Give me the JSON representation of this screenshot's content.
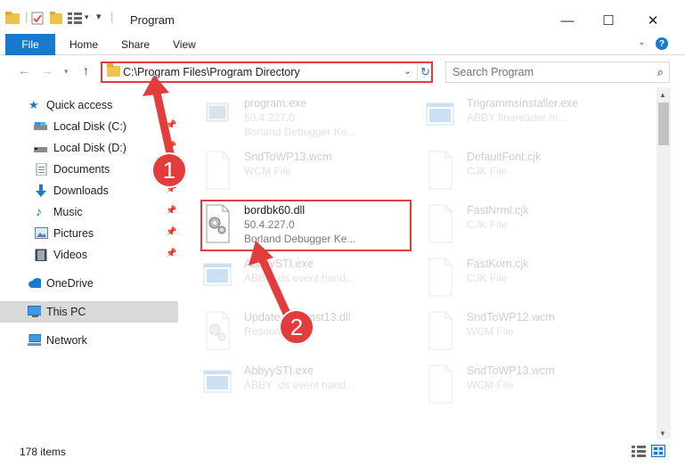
{
  "window": {
    "title": "Program",
    "minimize_glyph": "—",
    "maximize_glyph": "☐",
    "close_glyph": "✕"
  },
  "ribbon": {
    "tabs": [
      "File",
      "Home",
      "Share",
      "View"
    ],
    "help_label": "?"
  },
  "address_bar": {
    "path": "C:\\Program Files\\Program Directory"
  },
  "search": {
    "placeholder": "Search Program"
  },
  "sidebar": {
    "items": [
      {
        "label": "Quick access",
        "icon": "star-icon"
      },
      {
        "label": "Local Disk (C:)",
        "icon": "drive-icon",
        "pinned": true
      },
      {
        "label": "Local Disk (D:)",
        "icon": "drive-icon",
        "pinned": true
      },
      {
        "label": "Documents",
        "icon": "documents-icon",
        "pinned": true
      },
      {
        "label": "Downloads",
        "icon": "downloads-icon",
        "pinned": true
      },
      {
        "label": "Music",
        "icon": "music-icon",
        "pinned": true
      },
      {
        "label": "Pictures",
        "icon": "pictures-icon",
        "pinned": true
      },
      {
        "label": "Videos",
        "icon": "videos-icon",
        "pinned": true
      },
      {
        "label": "OneDrive",
        "icon": "onedrive-icon"
      },
      {
        "label": "This PC",
        "icon": "this-pc-icon",
        "selected": true
      },
      {
        "label": "Network",
        "icon": "network-icon"
      }
    ]
  },
  "files": [
    {
      "name": "program.exe",
      "line1": "50.4.227.0",
      "line2": "Borland Debugger Ke...",
      "icon": "exe-icon",
      "faded": true
    },
    {
      "name": "Trigrammsinstaller.exe",
      "line1": "ABBY finereader tri...",
      "line2": "",
      "icon": "app-window-icon",
      "faded": true
    },
    {
      "name": "SndToWP13.wcm",
      "line1": "WCM File",
      "line2": "",
      "icon": "file-icon",
      "faded": true
    },
    {
      "name": "DefaultFont.cjk",
      "line1": "CJK File",
      "line2": "",
      "icon": "file-icon",
      "faded": true
    },
    {
      "name": "bordbk60.dll",
      "line1": "50.4.227.0",
      "line2": "Borland Debugger Ke...",
      "icon": "dll-gear-icon",
      "faded": false
    },
    {
      "name": "FastNrml.cjk",
      "line1": "CJK File",
      "line2": "",
      "icon": "file-icon",
      "faded": true
    },
    {
      "name": "AbbyySTI.exe",
      "line1": "ABBY .ds event hand...",
      "line2": "",
      "icon": "app-window-icon",
      "faded": true
    },
    {
      "name": "FastKorn.cjk",
      "line1": "CJK File",
      "line2": "",
      "icon": "file-icon",
      "faded": true
    },
    {
      "name": "Update_1Uninst13.dll",
      "line1": "Resource DLL",
      "line2": "",
      "icon": "dll-gear-icon",
      "faded": true
    },
    {
      "name": "SndToWP12.wcm",
      "line1": "WCM File",
      "line2": "",
      "icon": "file-icon",
      "faded": true
    },
    {
      "name": "AbbyySTI.exe",
      "line1": "ABBY .ds event hand...",
      "line2": "",
      "icon": "app-window-icon",
      "faded": true
    },
    {
      "name": "SndToWP13.wcm",
      "line1": "WCM File",
      "line2": "",
      "icon": "file-icon",
      "faded": true
    }
  ],
  "status": {
    "item_count": "178 items"
  },
  "annotations": {
    "step1": "1",
    "step2": "2"
  },
  "colors": {
    "accent": "#1979ca",
    "annotation_red": "#e23c3c",
    "selected_bg": "#d9d9d9",
    "folder_yellow": "#f0c14b"
  }
}
